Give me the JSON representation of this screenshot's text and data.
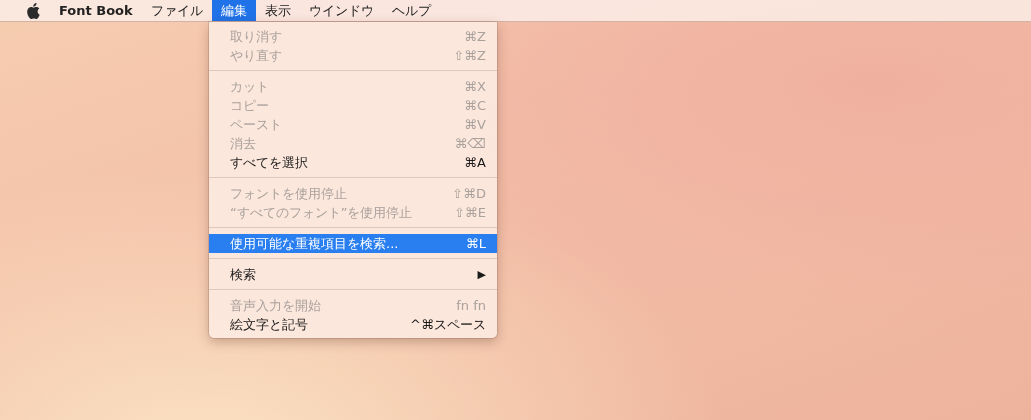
{
  "menu_bar": {
    "app_name": "Font Book",
    "menus": [
      {
        "label": "ファイル",
        "selected": false
      },
      {
        "label": "編集",
        "selected": true
      },
      {
        "label": "表示",
        "selected": false
      },
      {
        "label": "ウインドウ",
        "selected": false
      },
      {
        "label": "ヘルプ",
        "selected": false
      }
    ]
  },
  "edit_menu": {
    "items": [
      {
        "kind": "item",
        "label": "取り消す",
        "shortcut": "⌘Z",
        "disabled": true,
        "selected": false
      },
      {
        "kind": "item",
        "label": "やり直す",
        "shortcut": "⇧⌘Z",
        "disabled": true,
        "selected": false
      },
      {
        "kind": "separator"
      },
      {
        "kind": "item",
        "label": "カット",
        "shortcut": "⌘X",
        "disabled": true,
        "selected": false
      },
      {
        "kind": "item",
        "label": "コピー",
        "shortcut": "⌘C",
        "disabled": true,
        "selected": false
      },
      {
        "kind": "item",
        "label": "ペースト",
        "shortcut": "⌘V",
        "disabled": true,
        "selected": false
      },
      {
        "kind": "item",
        "label": "消去",
        "shortcut": "⌘⌫",
        "disabled": true,
        "selected": false
      },
      {
        "kind": "item",
        "label": "すべてを選択",
        "shortcut": "⌘A",
        "disabled": false,
        "selected": false
      },
      {
        "kind": "separator"
      },
      {
        "kind": "item",
        "label": "フォントを使用停止",
        "shortcut": "⇧⌘D",
        "disabled": true,
        "selected": false
      },
      {
        "kind": "item",
        "label": "“すべてのフォント”を使用停止",
        "shortcut": "⇧⌘E",
        "disabled": true,
        "selected": false
      },
      {
        "kind": "separator"
      },
      {
        "kind": "item",
        "label": "使用可能な重複項目を検索...",
        "shortcut": "⌘L",
        "disabled": false,
        "selected": true
      },
      {
        "kind": "separator"
      },
      {
        "kind": "submenu",
        "label": "検索",
        "shortcut": "▶",
        "disabled": false,
        "selected": false
      },
      {
        "kind": "separator"
      },
      {
        "kind": "item",
        "label": "音声入力を開始",
        "shortcut": "fn fn",
        "disabled": true,
        "selected": false
      },
      {
        "kind": "item",
        "label": "絵文字と記号",
        "shortcut": "^⌘スペース",
        "disabled": false,
        "selected": false
      }
    ]
  }
}
